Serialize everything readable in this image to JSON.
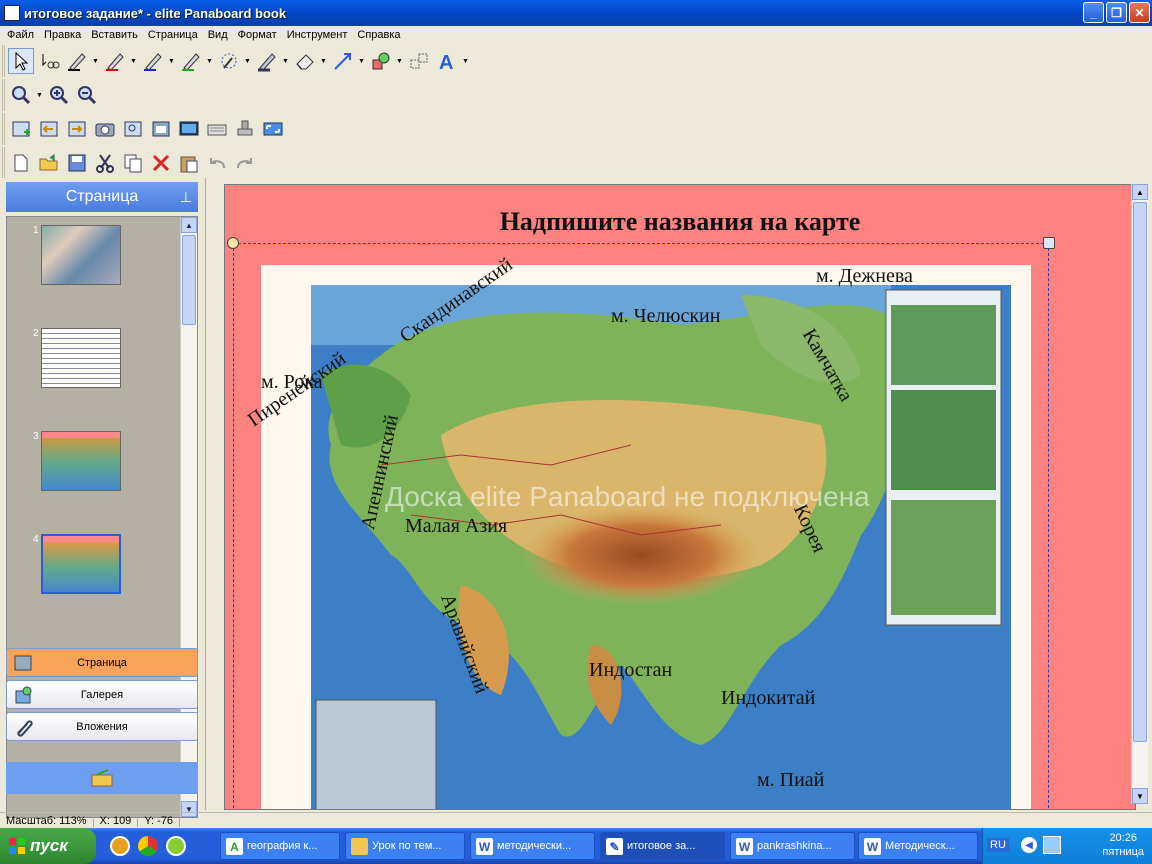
{
  "window": {
    "title": "итоговое задание* - elite Panaboard book"
  },
  "menu": [
    "Файл",
    "Правка",
    "Вставить",
    "Страница",
    "Вид",
    "Формат",
    "Инструмент",
    "Справка"
  ],
  "side_panel": {
    "header": "Страница",
    "thumb_numbers": [
      "1",
      "2",
      "3",
      "4"
    ],
    "nav": {
      "page": "Страница",
      "gallery": "Галерея",
      "attachments": "Вложения"
    }
  },
  "canvas": {
    "title": "Надпишите названия на карте",
    "watermark": "Доска elite Panaboard не подключена",
    "labels": {
      "dezhnev": "м. Дежнева",
      "chelyuskin": "м. Челюскин",
      "skandinavsky": "Скандинавский",
      "roka": "м. Рока",
      "pireneisky": "Пиренейский",
      "kamchatka": "Камчатка",
      "appeninsky": "Апеннинский",
      "malaya_aziya": "Малая Азия",
      "koreya": "Корея",
      "araviysky": "Аравийский",
      "indostan": "Индостан",
      "indokitai": "Индокитай",
      "piai": "м. Пиай"
    }
  },
  "status": {
    "zoom": "Масштаб: 113%",
    "x": "X: 109",
    "y": "Y: -76"
  },
  "taskbar": {
    "start": "пуск",
    "tasks": [
      "география к...",
      "Урок по тем...",
      "методически...",
      "итоговое за...",
      "pankrashkina...",
      "Методическ..."
    ],
    "lang": "RU",
    "time": "20:26",
    "day": "пятница"
  }
}
